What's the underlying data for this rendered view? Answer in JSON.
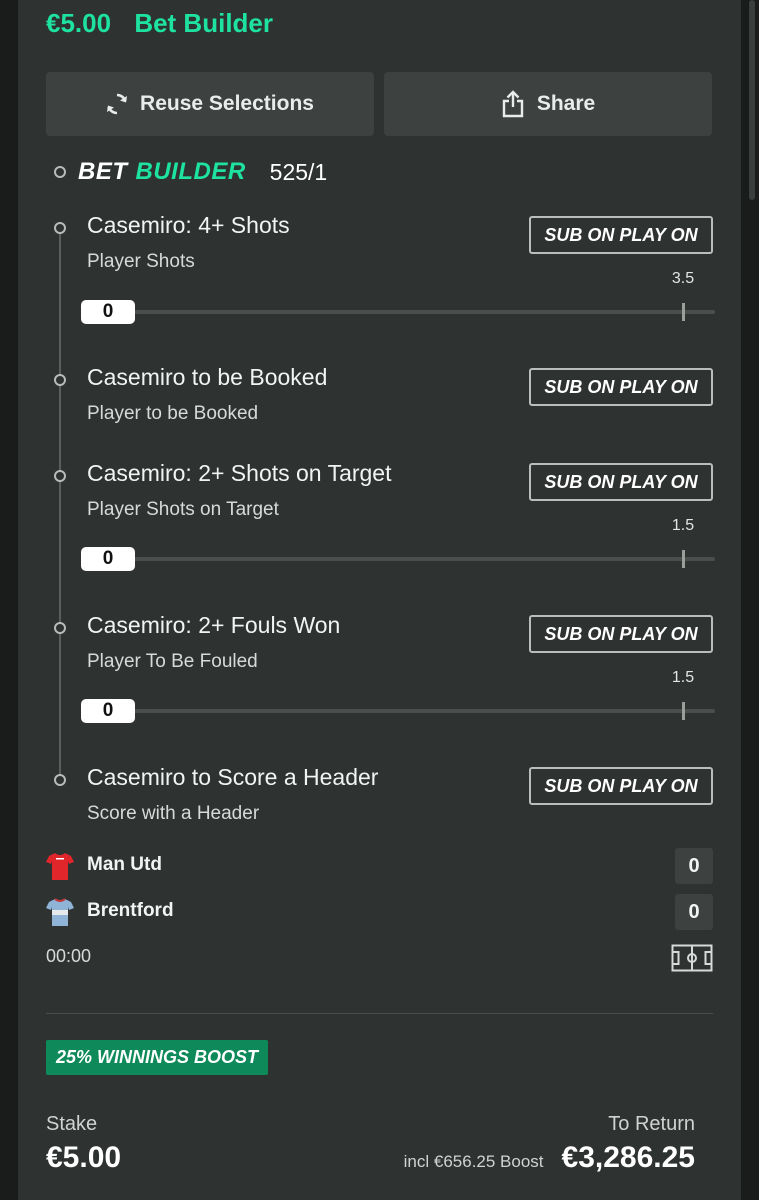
{
  "header": {
    "stake": "€5.00",
    "bet_type": "Bet Builder"
  },
  "actions": {
    "reuse_label": "Reuse Selections",
    "share_label": "Share"
  },
  "bet_builder": {
    "word1": "BET",
    "word2": "BUILDER",
    "odds": "525/1"
  },
  "selections": [
    {
      "title": "Casemiro: 4+ Shots",
      "market": "Player Shots",
      "sub_label": "SUB ON PLAY ON",
      "tracker": {
        "current": "0",
        "line": "3.5",
        "progress": 0
      }
    },
    {
      "title": "Casemiro to be Booked",
      "market": "Player to be Booked",
      "sub_label": "SUB ON PLAY ON"
    },
    {
      "title": "Casemiro: 2+ Shots on Target",
      "market": "Player Shots on Target",
      "sub_label": "SUB ON PLAY ON",
      "tracker": {
        "current": "0",
        "line": "1.5",
        "progress": 0
      }
    },
    {
      "title": "Casemiro: 2+ Fouls Won",
      "market": "Player To Be Fouled",
      "sub_label": "SUB ON PLAY ON",
      "tracker": {
        "current": "0",
        "line": "1.5",
        "progress": 0
      }
    },
    {
      "title": "Casemiro to Score a Header",
      "market": "Score with a Header",
      "sub_label": "SUB ON PLAY ON"
    }
  ],
  "match": {
    "home": {
      "name": "Man Utd",
      "score": "0",
      "shirt_color": "#e0252b"
    },
    "away": {
      "name": "Brentford",
      "score": "0",
      "shirt_color": "#8fb4d8"
    },
    "clock": "00:00"
  },
  "boost": {
    "label": "25% WINNINGS BOOST",
    "color": "#0e8a5a"
  },
  "footer": {
    "stake_label": "Stake",
    "stake_value": "€5.00",
    "return_label": "To Return",
    "boost_note": "incl €656.25 Boost",
    "return_value": "€3,286.25"
  },
  "colors": {
    "accent": "#1ee2a0",
    "card_bg": "#2e3230",
    "button_bg": "#3d4240"
  }
}
